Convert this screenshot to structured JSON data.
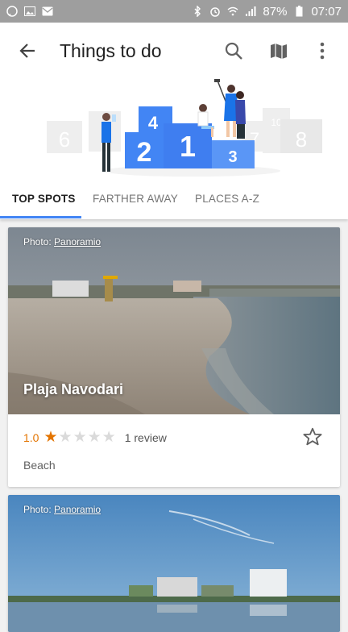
{
  "status_bar": {
    "battery": "87%",
    "time": "07:07",
    "icons": [
      "whatsapp-icon",
      "image-icon",
      "mail-icon",
      "bluetooth-icon",
      "alarm-icon",
      "wifi-icon",
      "signal-icon",
      "battery-icon"
    ]
  },
  "app_bar": {
    "title": "Things to do",
    "icons": [
      "back-arrow-icon",
      "search-icon",
      "map-icon",
      "more-vert-icon"
    ]
  },
  "hero": {
    "podium_numbers": [
      "6",
      "4",
      "2",
      "1",
      "3",
      "7",
      "10",
      "8"
    ]
  },
  "tabs": [
    {
      "label": "TOP SPOTS",
      "active": true
    },
    {
      "label": "FARTHER AWAY",
      "active": false
    },
    {
      "label": "PLACES A-Z",
      "active": false
    }
  ],
  "cards": [
    {
      "photo_prefix": "Photo: ",
      "photo_source": "Panoramio",
      "name": "Plaja Navodari",
      "rating": "1.0",
      "stars_filled": 1,
      "stars_total": 5,
      "reviews": "1 review",
      "category": "Beach"
    },
    {
      "photo_prefix": "Photo: ",
      "photo_source": "Panoramio"
    }
  ],
  "colors": {
    "accent": "#4285f4",
    "star": "#e37400",
    "status_bar": "#9e9e9e"
  }
}
